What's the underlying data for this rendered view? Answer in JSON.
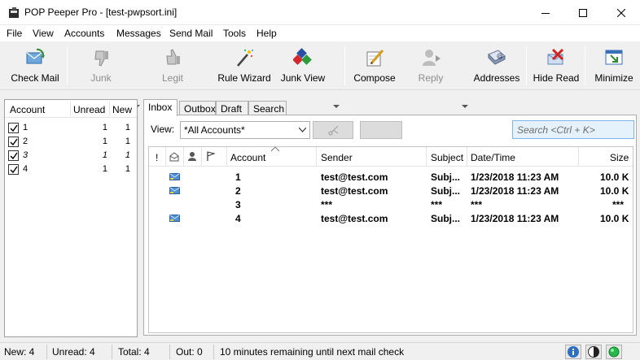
{
  "window": {
    "title": "POP Peeper Pro - [test-pwpsort.ini]",
    "icon": "pop-peeper-app-icon"
  },
  "menu": [
    {
      "label": "File"
    },
    {
      "label": "View"
    },
    {
      "label": "Accounts"
    },
    {
      "label": "Messages"
    },
    {
      "label": "Send Mail"
    },
    {
      "label": "Tools"
    },
    {
      "label": "Help"
    }
  ],
  "toolbar": {
    "check_mail": "Check Mail",
    "junk": "Junk",
    "legit": "Legit",
    "rule_wizard": "Rule Wizard",
    "junk_view": "Junk View",
    "compose": "Compose",
    "reply": "Reply",
    "addresses": "Addresses",
    "hide_read": "Hide Read",
    "minimize": "Minimize"
  },
  "accounts_panel": {
    "headers": {
      "account": "Account",
      "unread": "Unread",
      "new": "New"
    },
    "rows": [
      {
        "name": "1",
        "unread": "1",
        "new": "1",
        "checked": true,
        "italic": false
      },
      {
        "name": "2",
        "unread": "1",
        "new": "1",
        "checked": true,
        "italic": false
      },
      {
        "name": "3",
        "unread": "1",
        "new": "1",
        "checked": true,
        "italic": true
      },
      {
        "name": "4",
        "unread": "1",
        "new": "1",
        "checked": true,
        "italic": false
      }
    ]
  },
  "tabs": [
    {
      "label": "Inbox",
      "active": true
    },
    {
      "label": "Outbox",
      "active": false
    },
    {
      "label": "Draft",
      "active": false
    },
    {
      "label": "Search",
      "active": false
    }
  ],
  "view_filter": {
    "label": "View:",
    "selected": "*All Accounts*"
  },
  "search": {
    "placeholder": "Search <Ctrl + K>"
  },
  "message_list": {
    "headers": {
      "flag": "!",
      "account": "Account",
      "sender": "Sender",
      "subject": "Subject",
      "date": "Date/Time",
      "size": "Size"
    },
    "rows": [
      {
        "account": "1",
        "sender": "test@test.com",
        "subject": "Subj...",
        "date": "1/23/2018 11:23 AM",
        "size": "10.0 K",
        "has_icon": true
      },
      {
        "account": "2",
        "sender": "test@test.com",
        "subject": "Subj...",
        "date": "1/23/2018 11:23 AM",
        "size": "10.0 K",
        "has_icon": true
      },
      {
        "account": "3",
        "sender": "***",
        "subject": "***",
        "date": "***",
        "size": "***",
        "has_icon": false
      },
      {
        "account": "4",
        "sender": "test@test.com",
        "subject": "Subj...",
        "date": "1/23/2018 11:23 AM",
        "size": "10.0 K",
        "has_icon": true
      }
    ]
  },
  "status": {
    "new": "New: 4",
    "unread": "Unread: 4",
    "total": "Total: 4",
    "out": "Out: 0",
    "message": "10 minutes remaining until next mail check"
  }
}
